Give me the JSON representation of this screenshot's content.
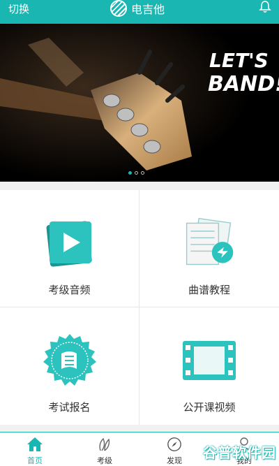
{
  "header": {
    "switch_label": "切换",
    "title": "电吉他"
  },
  "banner": {
    "text_line1": "LET'S",
    "text_line2": "BAND!",
    "dots": 3,
    "active_dot": 0
  },
  "grid": {
    "items": [
      {
        "label": "考级音频",
        "icon": "play-icon"
      },
      {
        "label": "曲谱教程",
        "icon": "sheet-music-icon"
      },
      {
        "label": "考试报名",
        "icon": "badge-icon"
      },
      {
        "label": "公开课视频",
        "icon": "film-icon"
      }
    ]
  },
  "nav": {
    "items": [
      {
        "label": "首页",
        "icon": "home-icon",
        "active": true
      },
      {
        "label": "考级",
        "icon": "level-icon"
      },
      {
        "label": "发现",
        "icon": "compass-icon"
      },
      {
        "label": "我的",
        "icon": "user-icon"
      }
    ]
  },
  "watermark": "谷普软件园",
  "colors": {
    "accent": "#19b6b2",
    "icon_fill": "#2cc3bf"
  }
}
